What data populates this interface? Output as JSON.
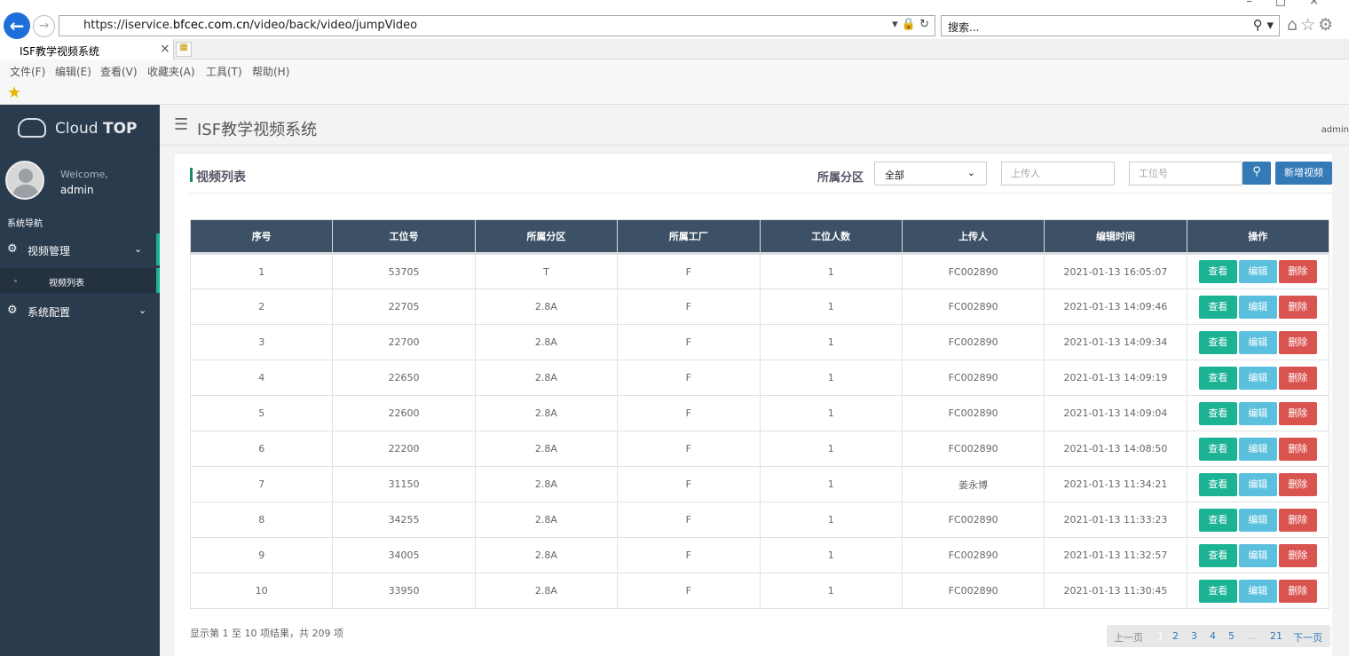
{
  "browser": {
    "url_prefix": "https://iservice.",
    "url_domain": "bfcec.com.cn",
    "url_path": "/video/back/video/jumpVideo",
    "search_placeholder": "搜索...",
    "tab_title": "ISF教学视频系统",
    "menu": [
      "文件(F)",
      "编辑(E)",
      "查看(V)",
      "收藏夹(A)",
      "工具(T)",
      "帮助(H)"
    ]
  },
  "sidebar": {
    "brand_light": "Cloud ",
    "brand_bold": "TOP",
    "welcome": "Welcome,",
    "username": "admin",
    "nav_heading": "系统导航",
    "items": [
      {
        "label": "视频管理"
      },
      {
        "label": "系统配置"
      }
    ],
    "sub_items": [
      {
        "label": "视频列表"
      }
    ],
    "accent": "#1bb394"
  },
  "header": {
    "title": "ISF教学视频系统",
    "user": "admin"
  },
  "panel": {
    "title": "视频列表",
    "filter_label": "所属分区",
    "select_value": "全部",
    "uploader_placeholder": "上传人",
    "station_placeholder": "工位号",
    "add_label": "新增视频"
  },
  "table": {
    "columns": [
      "序号",
      "工位号",
      "所属分区",
      "所属工厂",
      "工位人数",
      "上传人",
      "编辑时间",
      "操作"
    ],
    "rows": [
      [
        "1",
        "53705",
        "T",
        "F",
        "1",
        "FC002890",
        "2021-01-13 16:05:07"
      ],
      [
        "2",
        "22705",
        "2.8A",
        "F",
        "1",
        "FC002890",
        "2021-01-13 14:09:46"
      ],
      [
        "3",
        "22700",
        "2.8A",
        "F",
        "1",
        "FC002890",
        "2021-01-13 14:09:34"
      ],
      [
        "4",
        "22650",
        "2.8A",
        "F",
        "1",
        "FC002890",
        "2021-01-13 14:09:19"
      ],
      [
        "5",
        "22600",
        "2.8A",
        "F",
        "1",
        "FC002890",
        "2021-01-13 14:09:04"
      ],
      [
        "6",
        "22200",
        "2.8A",
        "F",
        "1",
        "FC002890",
        "2021-01-13 14:08:50"
      ],
      [
        "7",
        "31150",
        "2.8A",
        "F",
        "1",
        "姜永博",
        "2021-01-13 11:34:21"
      ],
      [
        "8",
        "34255",
        "2.8A",
        "F",
        "1",
        "FC002890",
        "2021-01-13 11:33:23"
      ],
      [
        "9",
        "34005",
        "2.8A",
        "F",
        "1",
        "FC002890",
        "2021-01-13 11:32:57"
      ],
      [
        "10",
        "33950",
        "2.8A",
        "F",
        "1",
        "FC002890",
        "2021-01-13 11:30:45"
      ]
    ],
    "actions": {
      "view": "查看",
      "edit": "编辑",
      "delete": "删除"
    },
    "action_colors": {
      "view": "#1bb394",
      "edit": "#5bc0de",
      "delete": "#d9534f"
    },
    "header_color": "#3c5166"
  },
  "footer": {
    "info": "显示第 1 至 10 项结果，共 209 项",
    "prev": "上一页",
    "pages": [
      "1",
      "2",
      "3",
      "4",
      "5"
    ],
    "ellipsis": "...",
    "last": "21",
    "next": "下一页"
  }
}
